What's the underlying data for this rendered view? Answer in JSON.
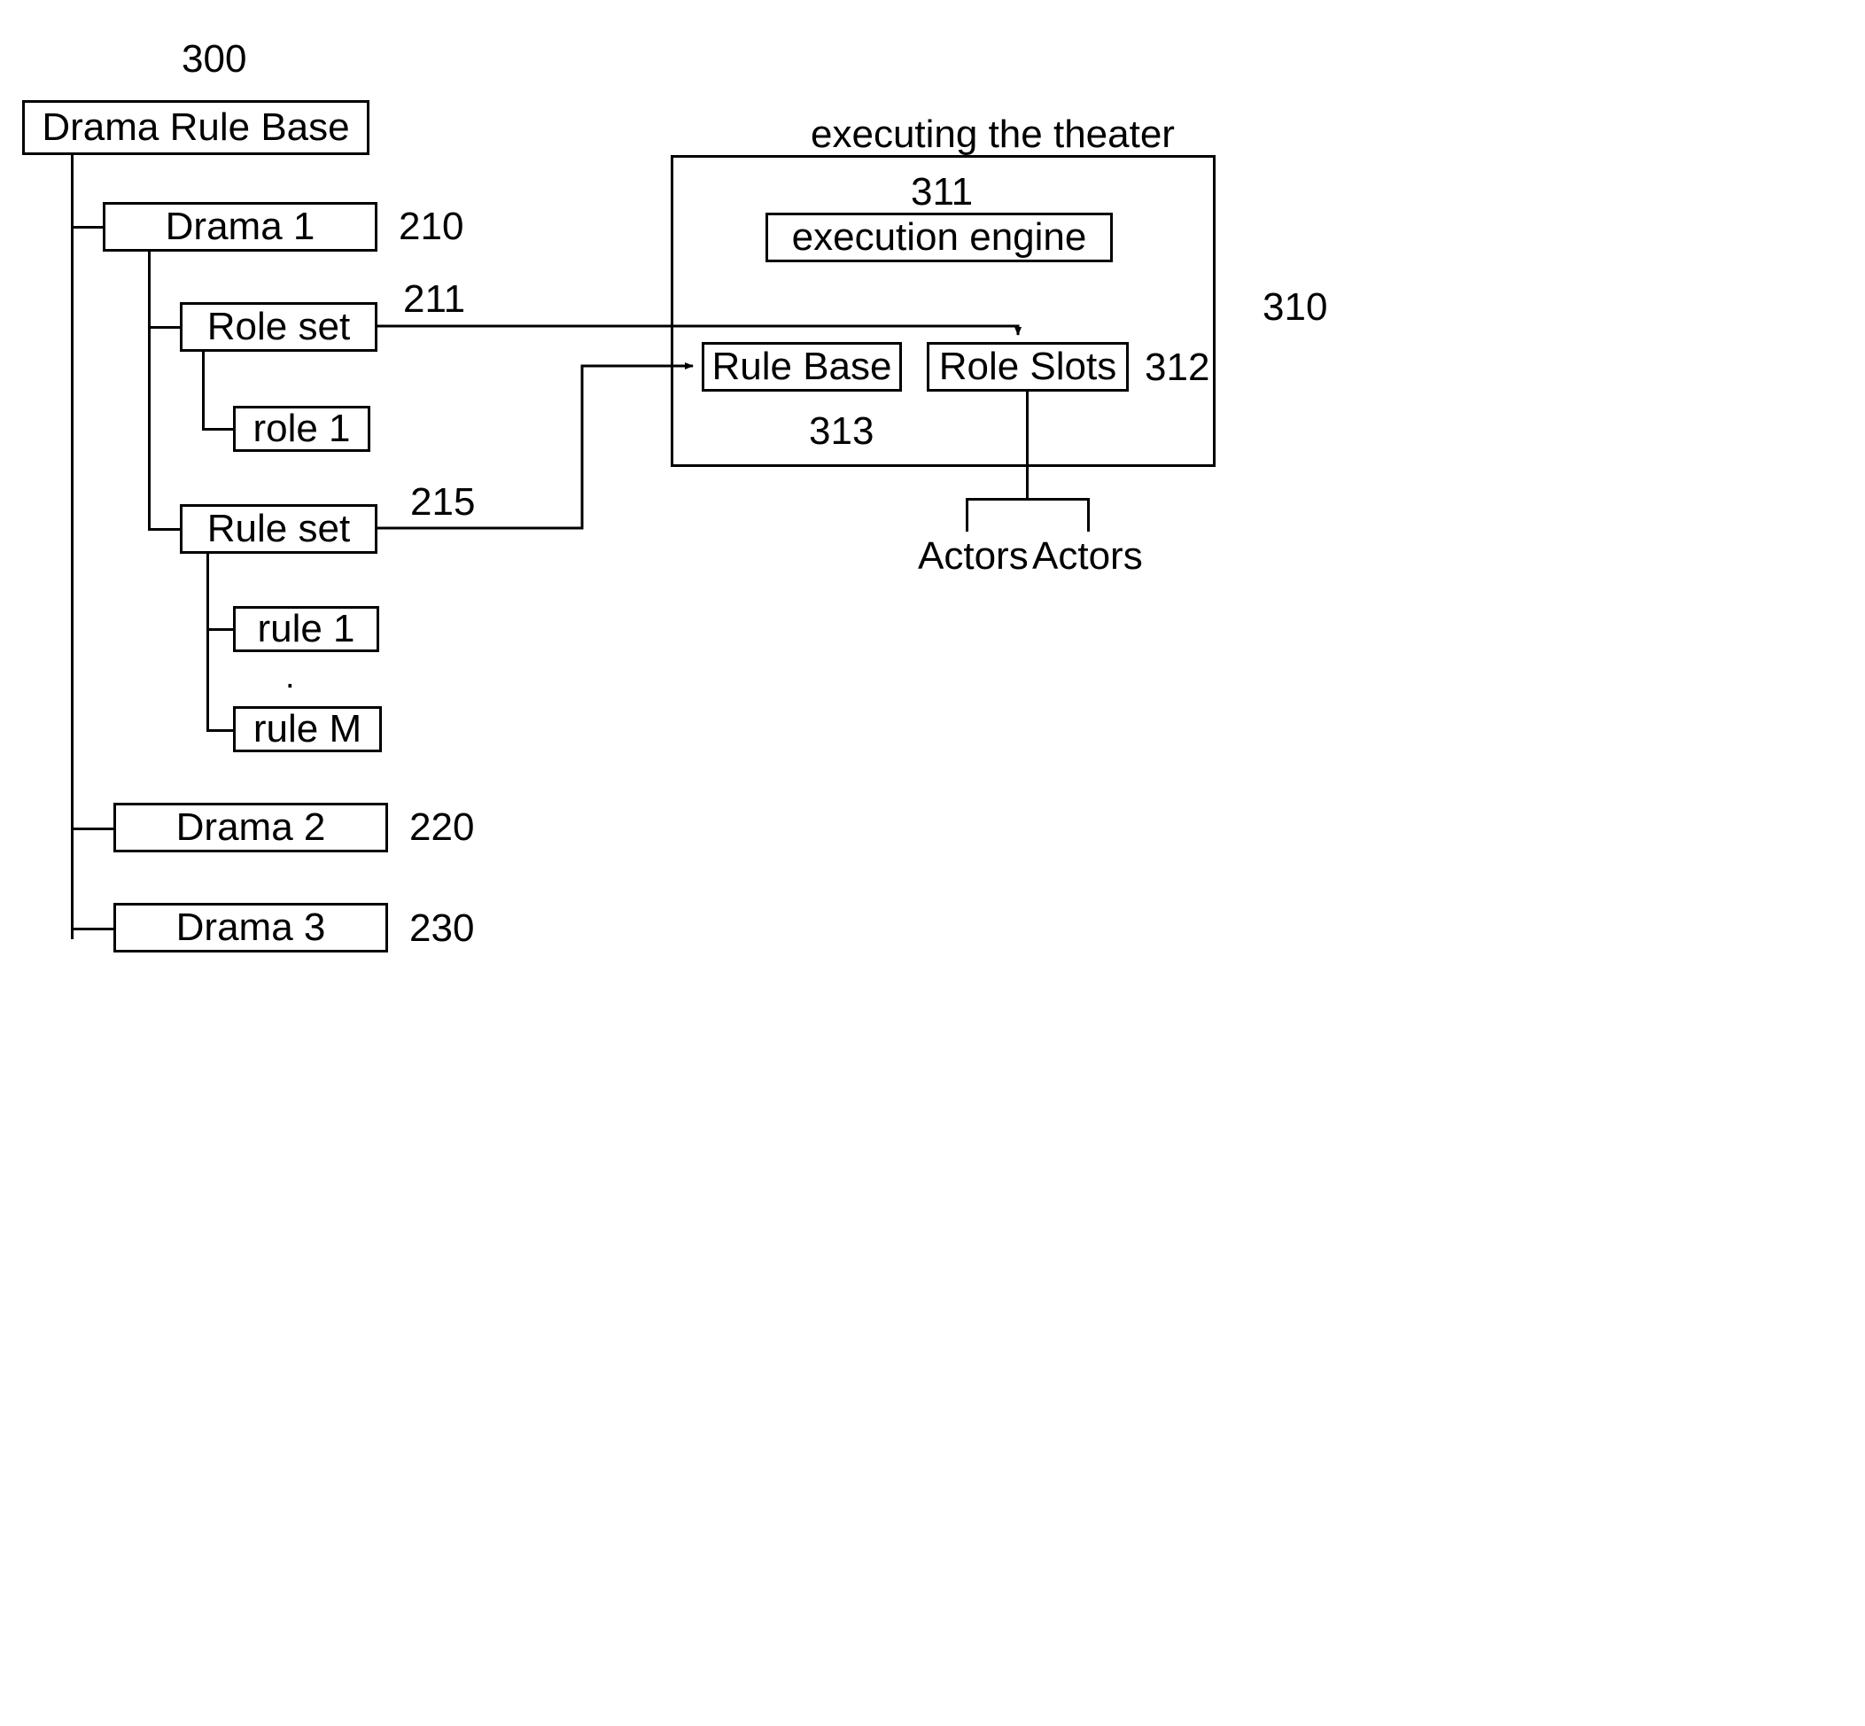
{
  "figure": {
    "root_ref": "300",
    "system_ref": "310",
    "system_title": "executing the theater"
  },
  "tree": {
    "root": {
      "label": "Drama Rule Base",
      "ref": "300"
    },
    "nodes": [
      {
        "label": "Drama 1",
        "ref": "210"
      },
      {
        "label": "Role set",
        "ref": "211"
      },
      {
        "label": "role 1",
        "ref": ""
      },
      {
        "label": "Rule set",
        "ref": "215"
      },
      {
        "label": "rule 1",
        "ref": ""
      },
      {
        "label": "rule M",
        "ref": ""
      },
      {
        "label": "Drama 2",
        "ref": "220"
      },
      {
        "label": "Drama 3",
        "ref": "230"
      }
    ],
    "ellipsis": "."
  },
  "theater": {
    "title": "executing the theater",
    "ref": "310",
    "engine": {
      "label": "execution engine",
      "ref": "311"
    },
    "rule_base": {
      "label": "Rule Base",
      "ref": "313"
    },
    "role_slots": {
      "label": "Role Slots",
      "ref": "312"
    }
  },
  "actors": {
    "left_label": "Actors",
    "right_label": "Actors"
  }
}
